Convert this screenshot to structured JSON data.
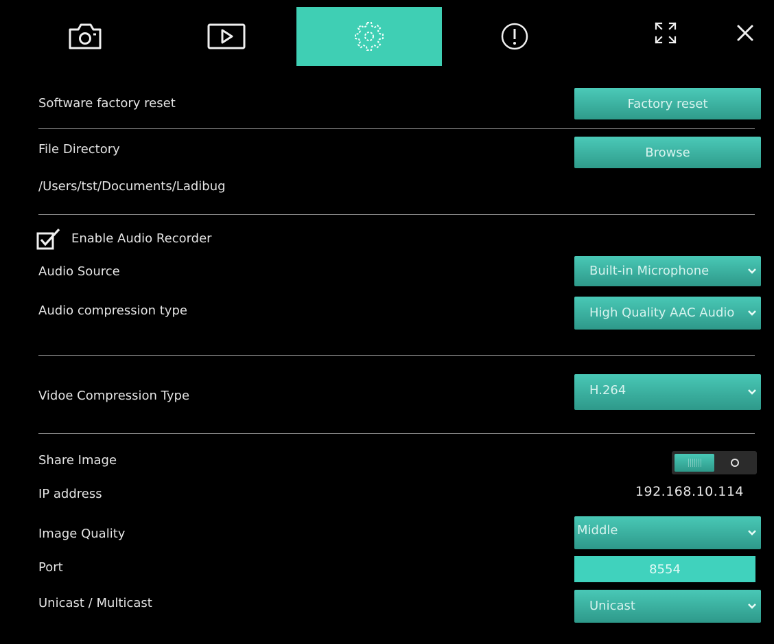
{
  "tabs": [
    {
      "id": "camera",
      "icon": "camera-icon",
      "active": false
    },
    {
      "id": "play",
      "icon": "play-icon",
      "active": false
    },
    {
      "id": "settings",
      "icon": "gear-icon",
      "active": true
    },
    {
      "id": "info",
      "icon": "info-icon",
      "active": false
    }
  ],
  "window_controls": {
    "fullscreen_icon": "fullscreen-icon",
    "close_icon": "close-icon"
  },
  "colors": {
    "accent": "#3fcfb4",
    "background": "#000000",
    "divider": "#8c8c8c"
  },
  "factory_reset": {
    "label": "Software factory reset",
    "button": "Factory reset"
  },
  "file_directory": {
    "label": "File Directory",
    "button": "Browse",
    "path": "/Users/tst/Documents/Ladibug"
  },
  "audio": {
    "enable_label": "Enable Audio Recorder",
    "enabled": true,
    "source_label": "Audio Source",
    "source_value": "Built-in Microphone",
    "compression_label": "Audio compression type",
    "compression_value": "High Quality AAC Audio"
  },
  "video": {
    "compression_label": "Vidoe Compression Type",
    "compression_value": "H.264"
  },
  "share": {
    "share_label": "Share Image",
    "share_enabled": true,
    "ip_label": "IP address",
    "ip_value": "192.168.10.114",
    "quality_label": "Image Quality",
    "quality_value": "Middle",
    "port_label": "Port",
    "port_value": "8554",
    "cast_label": "Unicast / Multicast",
    "cast_value": "Unicast"
  }
}
